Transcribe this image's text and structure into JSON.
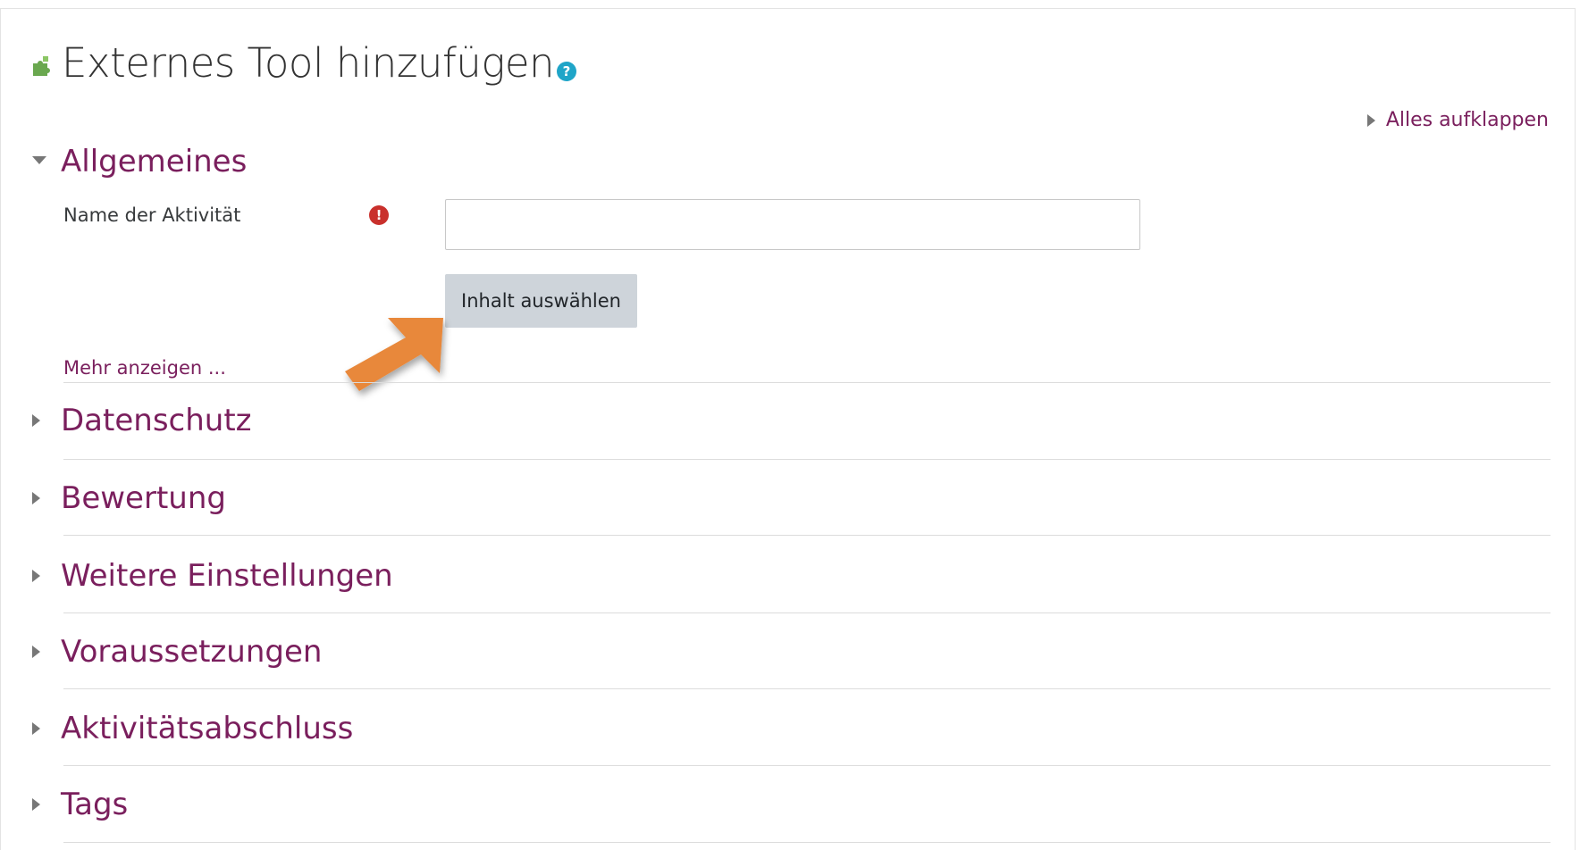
{
  "page": {
    "title": "Externes Tool hinzufügen",
    "help_icon": "?",
    "plugin_icon": "puzzle-piece-icon",
    "expand_all_label": "Alles aufklappen"
  },
  "general": {
    "heading": "Allgemeines",
    "activity_name_label": "Name der Aktivität",
    "activity_name_value": "",
    "required_icon": "!",
    "select_content_label": "Inhalt auswählen",
    "show_more_label": "Mehr anzeigen ..."
  },
  "sections": [
    {
      "label": "Datenschutz"
    },
    {
      "label": "Bewertung"
    },
    {
      "label": "Weitere Einstellungen"
    },
    {
      "label": "Voraussetzungen"
    },
    {
      "label": "Aktivitätsabschluss"
    },
    {
      "label": "Tags"
    }
  ],
  "colors": {
    "section_heading": "#7a1f5d",
    "button_bg": "#ced4da",
    "required_icon": "#c9302c",
    "help_icon": "#1fa5c8",
    "arrow": "#e8883a",
    "plugin_icon": "#6aa84f"
  }
}
